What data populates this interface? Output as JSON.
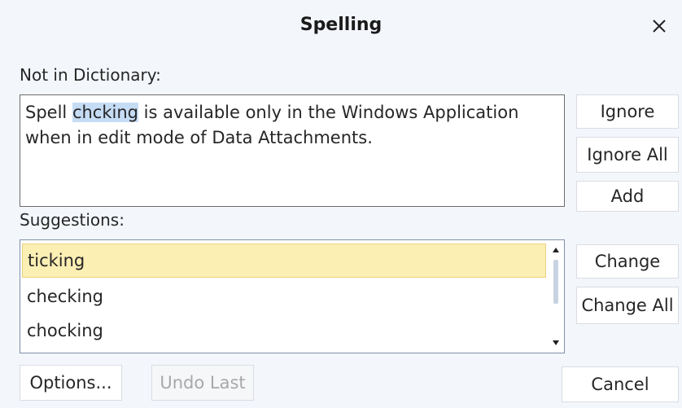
{
  "dialog": {
    "title": "Spelling",
    "close_icon": "close-icon"
  },
  "not_in_dictionary": {
    "label": "Not in Dictionary:",
    "text_before": "Spell ",
    "misspelled_word": "chcking",
    "text_after": " is available only in the Windows Application when in edit mode of Data Attachments."
  },
  "side_buttons_top": {
    "ignore": "Ignore",
    "ignore_all": "Ignore All",
    "add": "Add"
  },
  "suggestions": {
    "label": "Suggestions:",
    "items": [
      "ticking",
      "checking",
      "chocking"
    ],
    "selected": "ticking"
  },
  "side_buttons_bottom": {
    "change": "Change",
    "change_all": "Change All"
  },
  "footer": {
    "options": "Options...",
    "undo_last": "Undo Last",
    "cancel": "Cancel"
  },
  "colors": {
    "misspelled_highlight": "#c5dcf5",
    "selected_suggestion": "#fcefb4"
  }
}
